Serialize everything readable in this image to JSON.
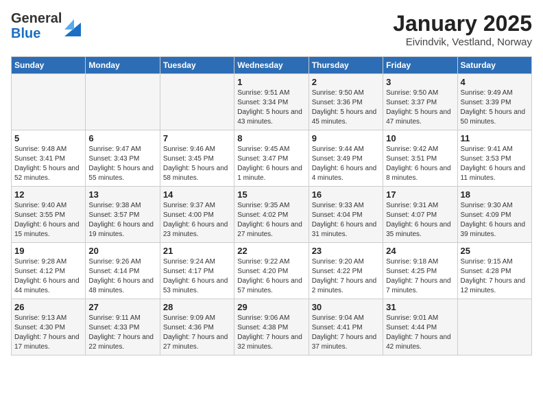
{
  "header": {
    "logo": {
      "general": "General",
      "blue": "Blue"
    },
    "title": "January 2025",
    "subtitle": "Eivindvik, Vestland, Norway"
  },
  "columns": [
    "Sunday",
    "Monday",
    "Tuesday",
    "Wednesday",
    "Thursday",
    "Friday",
    "Saturday"
  ],
  "weeks": [
    [
      {
        "day": "",
        "info": ""
      },
      {
        "day": "",
        "info": ""
      },
      {
        "day": "",
        "info": ""
      },
      {
        "day": "1",
        "info": "Sunrise: 9:51 AM\nSunset: 3:34 PM\nDaylight: 5 hours and 43 minutes."
      },
      {
        "day": "2",
        "info": "Sunrise: 9:50 AM\nSunset: 3:36 PM\nDaylight: 5 hours and 45 minutes."
      },
      {
        "day": "3",
        "info": "Sunrise: 9:50 AM\nSunset: 3:37 PM\nDaylight: 5 hours and 47 minutes."
      },
      {
        "day": "4",
        "info": "Sunrise: 9:49 AM\nSunset: 3:39 PM\nDaylight: 5 hours and 50 minutes."
      }
    ],
    [
      {
        "day": "5",
        "info": "Sunrise: 9:48 AM\nSunset: 3:41 PM\nDaylight: 5 hours and 52 minutes."
      },
      {
        "day": "6",
        "info": "Sunrise: 9:47 AM\nSunset: 3:43 PM\nDaylight: 5 hours and 55 minutes."
      },
      {
        "day": "7",
        "info": "Sunrise: 9:46 AM\nSunset: 3:45 PM\nDaylight: 5 hours and 58 minutes."
      },
      {
        "day": "8",
        "info": "Sunrise: 9:45 AM\nSunset: 3:47 PM\nDaylight: 6 hours and 1 minute."
      },
      {
        "day": "9",
        "info": "Sunrise: 9:44 AM\nSunset: 3:49 PM\nDaylight: 6 hours and 4 minutes."
      },
      {
        "day": "10",
        "info": "Sunrise: 9:42 AM\nSunset: 3:51 PM\nDaylight: 6 hours and 8 minutes."
      },
      {
        "day": "11",
        "info": "Sunrise: 9:41 AM\nSunset: 3:53 PM\nDaylight: 6 hours and 11 minutes."
      }
    ],
    [
      {
        "day": "12",
        "info": "Sunrise: 9:40 AM\nSunset: 3:55 PM\nDaylight: 6 hours and 15 minutes."
      },
      {
        "day": "13",
        "info": "Sunrise: 9:38 AM\nSunset: 3:57 PM\nDaylight: 6 hours and 19 minutes."
      },
      {
        "day": "14",
        "info": "Sunrise: 9:37 AM\nSunset: 4:00 PM\nDaylight: 6 hours and 23 minutes."
      },
      {
        "day": "15",
        "info": "Sunrise: 9:35 AM\nSunset: 4:02 PM\nDaylight: 6 hours and 27 minutes."
      },
      {
        "day": "16",
        "info": "Sunrise: 9:33 AM\nSunset: 4:04 PM\nDaylight: 6 hours and 31 minutes."
      },
      {
        "day": "17",
        "info": "Sunrise: 9:31 AM\nSunset: 4:07 PM\nDaylight: 6 hours and 35 minutes."
      },
      {
        "day": "18",
        "info": "Sunrise: 9:30 AM\nSunset: 4:09 PM\nDaylight: 6 hours and 39 minutes."
      }
    ],
    [
      {
        "day": "19",
        "info": "Sunrise: 9:28 AM\nSunset: 4:12 PM\nDaylight: 6 hours and 44 minutes."
      },
      {
        "day": "20",
        "info": "Sunrise: 9:26 AM\nSunset: 4:14 PM\nDaylight: 6 hours and 48 minutes."
      },
      {
        "day": "21",
        "info": "Sunrise: 9:24 AM\nSunset: 4:17 PM\nDaylight: 6 hours and 53 minutes."
      },
      {
        "day": "22",
        "info": "Sunrise: 9:22 AM\nSunset: 4:20 PM\nDaylight: 6 hours and 57 minutes."
      },
      {
        "day": "23",
        "info": "Sunrise: 9:20 AM\nSunset: 4:22 PM\nDaylight: 7 hours and 2 minutes."
      },
      {
        "day": "24",
        "info": "Sunrise: 9:18 AM\nSunset: 4:25 PM\nDaylight: 7 hours and 7 minutes."
      },
      {
        "day": "25",
        "info": "Sunrise: 9:15 AM\nSunset: 4:28 PM\nDaylight: 7 hours and 12 minutes."
      }
    ],
    [
      {
        "day": "26",
        "info": "Sunrise: 9:13 AM\nSunset: 4:30 PM\nDaylight: 7 hours and 17 minutes."
      },
      {
        "day": "27",
        "info": "Sunrise: 9:11 AM\nSunset: 4:33 PM\nDaylight: 7 hours and 22 minutes."
      },
      {
        "day": "28",
        "info": "Sunrise: 9:09 AM\nSunset: 4:36 PM\nDaylight: 7 hours and 27 minutes."
      },
      {
        "day": "29",
        "info": "Sunrise: 9:06 AM\nSunset: 4:38 PM\nDaylight: 7 hours and 32 minutes."
      },
      {
        "day": "30",
        "info": "Sunrise: 9:04 AM\nSunset: 4:41 PM\nDaylight: 7 hours and 37 minutes."
      },
      {
        "day": "31",
        "info": "Sunrise: 9:01 AM\nSunset: 4:44 PM\nDaylight: 7 hours and 42 minutes."
      },
      {
        "day": "",
        "info": ""
      }
    ]
  ]
}
